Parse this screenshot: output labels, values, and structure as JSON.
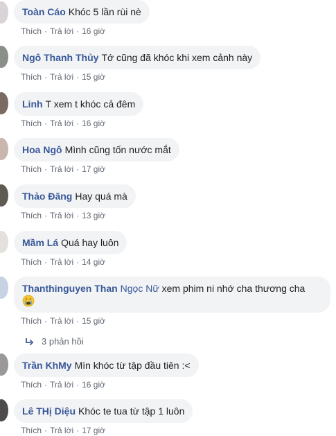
{
  "labels": {
    "like": "Thích",
    "reply": "Trả lời",
    "separator": "·"
  },
  "comments": [
    {
      "name": "Toàn Cáo",
      "text": "Khóc 5 lần rùi nè",
      "time": "16 giờ"
    },
    {
      "name": "Ngô Thanh Thủy",
      "text": "Tớ cũng đã khóc khi xem cảnh này",
      "time": "15 giờ"
    },
    {
      "name": "Linh",
      "text": "T xem t khóc cả đêm",
      "time": "16 giờ"
    },
    {
      "name": "Hoa Ngô",
      "text": "Mình cũng tốn nước mắt",
      "time": "17 giờ"
    },
    {
      "name": "Thảo Đăng",
      "text": "Hay quá mà",
      "time": "13 giờ"
    },
    {
      "name": "Mầm Lá",
      "text": "Quá hay luôn",
      "time": "14 giờ"
    },
    {
      "name": "Thanthinguyen Than",
      "mention": "Ngọc Nữ",
      "text": "xem phim ni nhớ cha thương cha",
      "time": "15 giờ"
    },
    {
      "name": "Trần KhMy",
      "text": "Mìn khóc từ tập đầu tiên :<",
      "time": "16 giờ"
    },
    {
      "name": "Lê THị Diệu",
      "text": "Khóc te tua từ tập 1 luôn",
      "time": "17 giờ"
    }
  ],
  "replies_link": {
    "text": "3 phản hồi"
  },
  "colors": {
    "name_link": "#385898",
    "bubble_bg": "#f2f3f5",
    "meta_text": "#606770"
  }
}
